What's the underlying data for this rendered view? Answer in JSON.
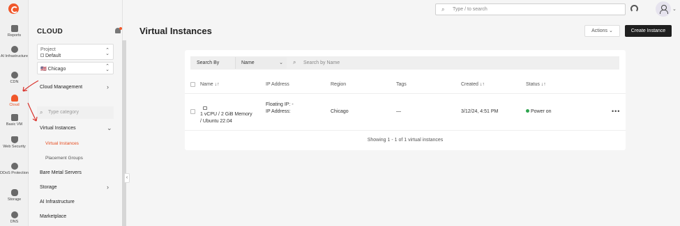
{
  "topbar": {
    "search_placeholder": "Type / to search"
  },
  "rail": {
    "items": [
      {
        "label": "Reports",
        "icon": "bar-chart-icon"
      },
      {
        "label": "AI Infrastructure",
        "icon": "ai-chip-icon"
      },
      {
        "label": "CDN",
        "icon": "speedometer-icon"
      },
      {
        "label": "Cloud",
        "icon": "cloud-icon",
        "active": true
      },
      {
        "label": "Basic VM",
        "icon": "cube-icon"
      },
      {
        "label": "Web Security",
        "icon": "shield-icon"
      },
      {
        "label": "DDoS Protection",
        "icon": "globe-icon"
      },
      {
        "label": "Storage",
        "icon": "database-icon"
      },
      {
        "label": "DNS",
        "icon": "dns-icon"
      }
    ]
  },
  "sidenav": {
    "title": "CLOUD",
    "project_label": "Project",
    "project_value": "Default",
    "region_value": "🇺🇸 Chicago",
    "cloud_management": "Cloud Management",
    "category_placeholder": "Type category",
    "virtual_instances": "Virtual Instances",
    "virtual_instances_sub": "Virtual Instances",
    "placement_groups": "Placement Groups",
    "bare_metal": "Bare Metal Servers",
    "storage": "Storage",
    "ai_infrastructure": "AI Infrastructure",
    "marketplace": "Marketplace"
  },
  "header": {
    "title": "Virtual Instances",
    "actions_label": "Actions",
    "create_label": "Create Instance"
  },
  "filter": {
    "search_by_label": "Search By",
    "search_by_value": "Name",
    "search_placeholder": "Search by Name"
  },
  "table": {
    "columns": [
      "Name ↓↑",
      "IP Address",
      "Region",
      "Tags",
      "Created ↓↑",
      "Status ↓↑"
    ],
    "rows": [
      {
        "name_line1": "1 vCPU / 2 GiB Memory",
        "name_line2": "/ Ubuntu 22.04",
        "ip_line1": "Floating IP: -",
        "ip_line2": "IP Address:",
        "region": "Chicago",
        "tags": "—",
        "created": "3/12/24, 4:51 PM",
        "status": "Power on"
      }
    ],
    "footer": "Showing 1 - 1 of 1 virtual instances"
  },
  "colors": {
    "accent": "#f0572a",
    "status_on": "#2ea44f",
    "annotation": "#d9322b"
  }
}
